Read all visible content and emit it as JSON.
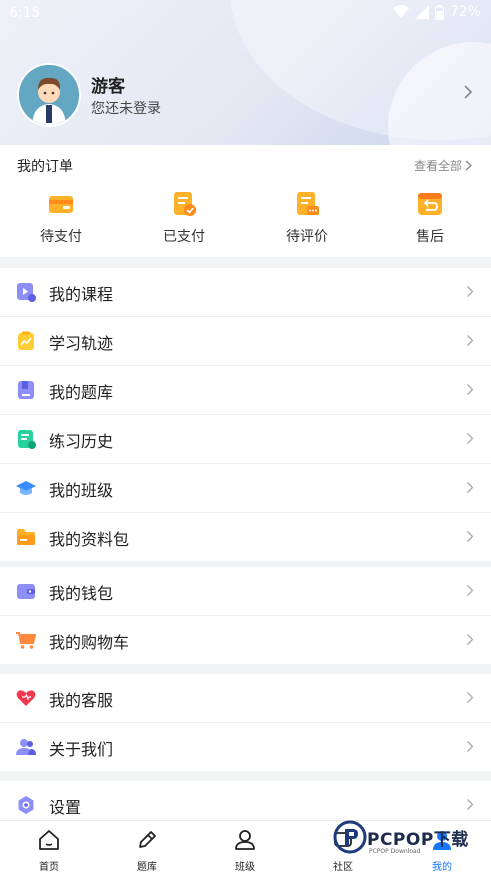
{
  "status_bar": {
    "time": "6:15",
    "battery": "72%"
  },
  "profile": {
    "name": "游客",
    "subtitle": "您还未登录"
  },
  "orders": {
    "title": "我的订单",
    "view_all": "查看全部",
    "items": [
      {
        "label": "待支付",
        "icon": "wallet-icon"
      },
      {
        "label": "已支付",
        "icon": "paid-doc-icon"
      },
      {
        "label": "待评价",
        "icon": "review-doc-icon"
      },
      {
        "label": "售后",
        "icon": "return-box-icon"
      }
    ]
  },
  "menu_group_1": [
    {
      "label": "我的课程",
      "icon": "course-video-icon"
    },
    {
      "label": "学习轨迹",
      "icon": "trend-chart-icon"
    },
    {
      "label": "我的题库",
      "icon": "question-bank-icon"
    },
    {
      "label": "练习历史",
      "icon": "practice-history-icon"
    },
    {
      "label": "我的班级",
      "icon": "graduation-cap-icon"
    },
    {
      "label": "我的资料包",
      "icon": "folder-icon"
    }
  ],
  "menu_group_2": [
    {
      "label": "我的钱包",
      "icon": "purse-icon"
    },
    {
      "label": "我的购物车",
      "icon": "shopping-cart-icon"
    }
  ],
  "menu_group_3": [
    {
      "label": "我的客服",
      "icon": "heart-icon"
    },
    {
      "label": "关于我们",
      "icon": "people-icon"
    }
  ],
  "menu_group_4": [
    {
      "label": "设置",
      "icon": "settings-gear-icon"
    }
  ],
  "tabbar": [
    {
      "label": "首页",
      "icon": "home-icon"
    },
    {
      "label": "题库",
      "icon": "pencil-icon"
    },
    {
      "label": "班级",
      "icon": "user-group-icon"
    },
    {
      "label": "社区",
      "icon": "community-icon"
    },
    {
      "label": "我的",
      "icon": "profile-icon",
      "active": true
    }
  ],
  "watermark": {
    "text": "PCPOP下载",
    "sub": "PCPOP Download"
  },
  "colors": {
    "accent": "#1677ff",
    "orange": "#ff9d1b",
    "page_bg": "#f2f3f5"
  }
}
